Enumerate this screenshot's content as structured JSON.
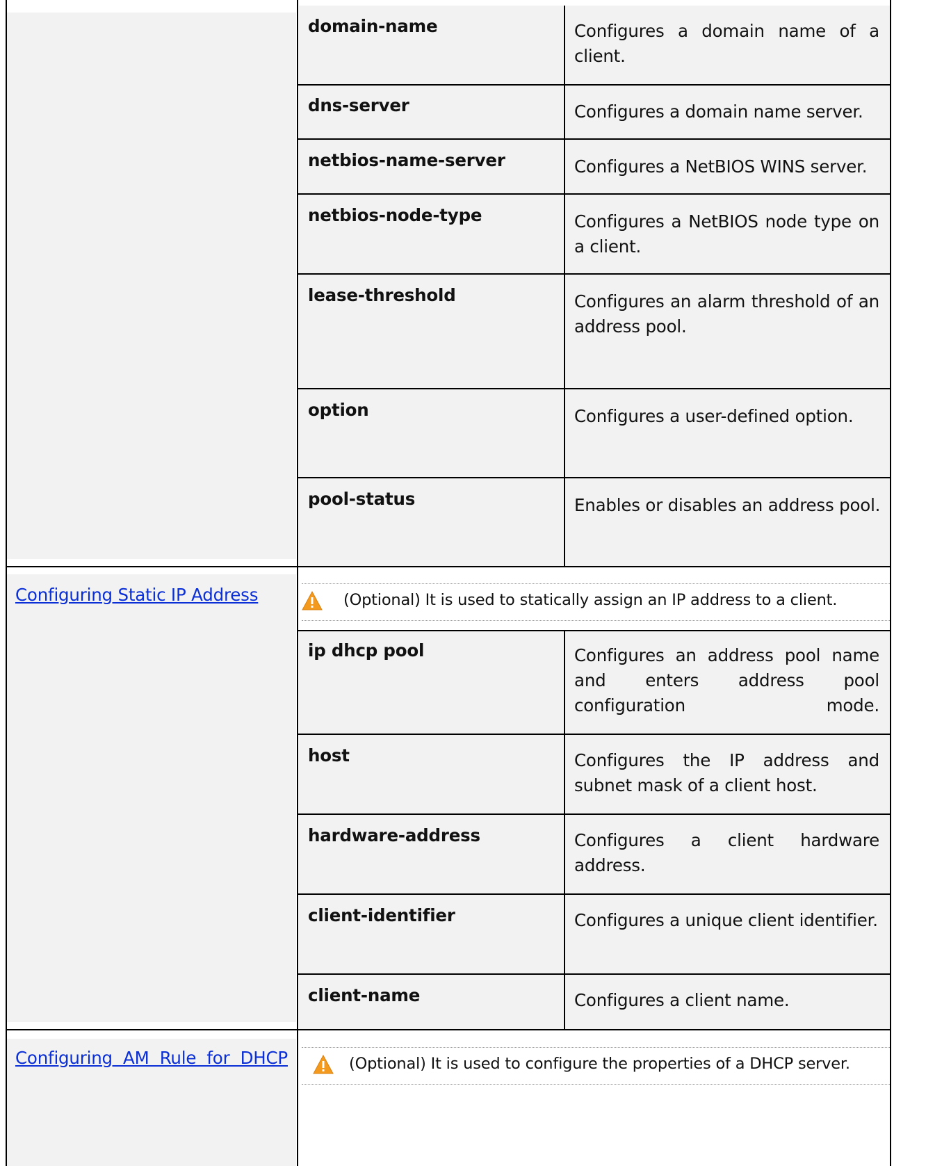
{
  "sections": [
    {
      "link": "",
      "note": "",
      "rows": [
        {
          "command": "domain-name",
          "description": "Configures a domain name of a client."
        },
        {
          "command": "dns-server",
          "description": "Configures a domain name server."
        },
        {
          "command": "netbios-name-server",
          "description": "Configures a NetBIOS WINS server."
        },
        {
          "command": "netbios-node-type",
          "description": "Configures a NetBIOS node type on a client."
        },
        {
          "command": "lease-threshold",
          "description": "Configures an alarm threshold of an address pool."
        },
        {
          "command": "option",
          "description": "Configures a user-defined option."
        },
        {
          "command": "pool-status",
          "description": "Enables or disables an address pool."
        }
      ]
    },
    {
      "link": "Configuring Static IP Address",
      "note": "(Optional) It is used to statically assign an IP address to a client.",
      "rows": [
        {
          "command": "ip dhcp pool",
          "description": "Configures an address pool name and enters address pool configuration mode."
        },
        {
          "command": "host",
          "description": "Configures the IP address and subnet mask of a client host."
        },
        {
          "command": "hardware-address",
          "description": "Configures a client hardware address."
        },
        {
          "command": "client-identifier",
          "description": "Configures a unique client identifier."
        },
        {
          "command": "client-name",
          "description": "Configures a client name."
        }
      ]
    },
    {
      "link": "Configuring AM Rule for DHCP",
      "note": "(Optional) It is used to configure the properties of a DHCP server.",
      "rows": []
    }
  ],
  "icons": {
    "note": "warning-triangle-icon"
  },
  "colors": {
    "link": "#0b2fd6",
    "shade": "#f2f2f2",
    "warning": "#f39a1e"
  }
}
